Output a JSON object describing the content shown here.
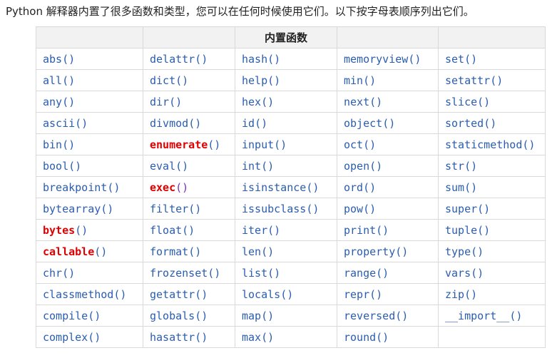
{
  "intro": "Python 解释器内置了很多函数和类型，您可以在任何时候使用它们。以下按字母表顺序列出它们。",
  "table": {
    "header": "内置函数",
    "columns": [
      [
        {
          "name": "abs",
          "paren": "()"
        },
        {
          "name": "all",
          "paren": "()"
        },
        {
          "name": "any",
          "paren": "()"
        },
        {
          "name": "ascii",
          "paren": "()"
        },
        {
          "name": "bin",
          "paren": "()"
        },
        {
          "name": "bool",
          "paren": "()"
        },
        {
          "name": "breakpoint",
          "paren": "()"
        },
        {
          "name": "bytearray",
          "paren": "()"
        },
        {
          "name": "bytes",
          "paren": "()",
          "highlight": true
        },
        {
          "name": "callable",
          "paren": "()",
          "highlight": true
        },
        {
          "name": "chr",
          "paren": "()"
        },
        {
          "name": "classmethod",
          "paren": "()"
        },
        {
          "name": "compile",
          "paren": "()"
        },
        {
          "name": "complex",
          "paren": "()"
        }
      ],
      [
        {
          "name": "delattr",
          "paren": "()"
        },
        {
          "name": "dict",
          "paren": "()"
        },
        {
          "name": "dir",
          "paren": "()"
        },
        {
          "name": "divmod",
          "paren": "()"
        },
        {
          "name": "enumerate",
          "paren": "()",
          "highlight": true
        },
        {
          "name": "eval",
          "paren": "()"
        },
        {
          "name": "exec",
          "paren": "()",
          "highlight": true,
          "paren_purple": true
        },
        {
          "name": "filter",
          "paren": "()"
        },
        {
          "name": "float",
          "paren": "()"
        },
        {
          "name": "format",
          "paren": "()"
        },
        {
          "name": "frozenset",
          "paren": "()"
        },
        {
          "name": "getattr",
          "paren": "()"
        },
        {
          "name": "globals",
          "paren": "()"
        },
        {
          "name": "hasattr",
          "paren": "()"
        }
      ],
      [
        {
          "name": "hash",
          "paren": "()"
        },
        {
          "name": "help",
          "paren": "()"
        },
        {
          "name": "hex",
          "paren": "()"
        },
        {
          "name": "id",
          "paren": "()"
        },
        {
          "name": "input",
          "paren": "()"
        },
        {
          "name": "int",
          "paren": "()"
        },
        {
          "name": "isinstance",
          "paren": "()"
        },
        {
          "name": "issubclass",
          "paren": "()"
        },
        {
          "name": "iter",
          "paren": "()"
        },
        {
          "name": "len",
          "paren": "()"
        },
        {
          "name": "list",
          "paren": "()"
        },
        {
          "name": "locals",
          "paren": "()"
        },
        {
          "name": "map",
          "paren": "()"
        },
        {
          "name": "max",
          "paren": "()"
        }
      ],
      [
        {
          "name": "memoryview",
          "paren": "()"
        },
        {
          "name": "min",
          "paren": "()"
        },
        {
          "name": "next",
          "paren": "()"
        },
        {
          "name": "object",
          "paren": "()"
        },
        {
          "name": "oct",
          "paren": "()"
        },
        {
          "name": "open",
          "paren": "()"
        },
        {
          "name": "ord",
          "paren": "()"
        },
        {
          "name": "pow",
          "paren": "()"
        },
        {
          "name": "print",
          "paren": "()"
        },
        {
          "name": "property",
          "paren": "()"
        },
        {
          "name": "range",
          "paren": "()"
        },
        {
          "name": "repr",
          "paren": "()"
        },
        {
          "name": "reversed",
          "paren": "()"
        },
        {
          "name": "round",
          "paren": "()"
        }
      ],
      [
        {
          "name": "set",
          "paren": "()"
        },
        {
          "name": "setattr",
          "paren": "()"
        },
        {
          "name": "slice",
          "paren": "()"
        },
        {
          "name": "sorted",
          "paren": "()"
        },
        {
          "name": "staticmethod",
          "paren": "()"
        },
        {
          "name": "str",
          "paren": "()"
        },
        {
          "name": "sum",
          "paren": "()"
        },
        {
          "name": "super",
          "paren": "()"
        },
        {
          "name": "tuple",
          "paren": "()"
        },
        {
          "name": "type",
          "paren": "()"
        },
        {
          "name": "vars",
          "paren": "()"
        },
        {
          "name": "zip",
          "paren": "()"
        },
        {
          "name": "__import__",
          "paren": "()"
        },
        {
          "name": "",
          "paren": ""
        }
      ]
    ]
  },
  "colors": {
    "link": "#2a5db0",
    "highlight": "#e00000",
    "highlight_paren": "#7a2fc0",
    "header_bg": "#f2f2f2",
    "border": "#d9d9d9"
  }
}
